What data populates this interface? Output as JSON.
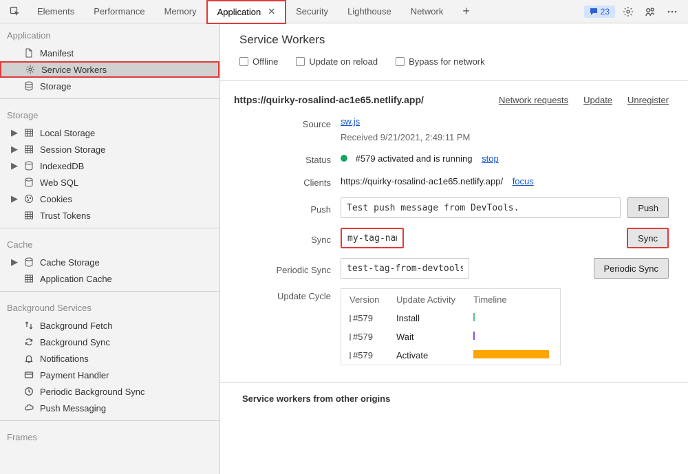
{
  "tabs": {
    "items": [
      "Elements",
      "Performance",
      "Memory",
      "Application",
      "Security",
      "Lighthouse",
      "Network"
    ],
    "active": "Application"
  },
  "issues_badge": {
    "count": "23"
  },
  "sidebar": {
    "application": {
      "title": "Application",
      "items": [
        "Manifest",
        "Service Workers",
        "Storage"
      ]
    },
    "storage": {
      "title": "Storage",
      "items": [
        "Local Storage",
        "Session Storage",
        "IndexedDB",
        "Web SQL",
        "Cookies",
        "Trust Tokens"
      ]
    },
    "cache": {
      "title": "Cache",
      "items": [
        "Cache Storage",
        "Application Cache"
      ]
    },
    "background": {
      "title": "Background Services",
      "items": [
        "Background Fetch",
        "Background Sync",
        "Notifications",
        "Payment Handler",
        "Periodic Background Sync",
        "Push Messaging"
      ]
    },
    "frames": {
      "title": "Frames"
    }
  },
  "header": {
    "title": "Service Workers",
    "checks": {
      "offline": "Offline",
      "update": "Update on reload",
      "bypass": "Bypass for network"
    }
  },
  "origin": {
    "url": "https://quirky-rosalind-ac1e65.netlify.app/",
    "actions": {
      "requests": "Network requests",
      "update": "Update",
      "unregister": "Unregister"
    }
  },
  "fields": {
    "source_lbl": "Source",
    "source_link": "sw.js",
    "received": "Received 9/21/2021, 2:49:11 PM",
    "status_lbl": "Status",
    "status_text": "#579 activated and is running",
    "status_stop": "stop",
    "clients_lbl": "Clients",
    "clients_url": "https://quirky-rosalind-ac1e65.netlify.app/",
    "clients_focus": "focus",
    "push_lbl": "Push",
    "push_val": "Test push message from DevTools.",
    "push_btn": "Push",
    "sync_lbl": "Sync",
    "sync_val": "my-tag-name",
    "sync_btn": "Sync",
    "psync_lbl": "Periodic Sync",
    "psync_val": "test-tag-from-devtools",
    "psync_btn": "Periodic Sync",
    "uc_lbl": "Update Cycle"
  },
  "update_cycle": {
    "head": {
      "c1": "Version",
      "c2": "Update Activity",
      "c3": "Timeline"
    },
    "rows": [
      {
        "version": "#579",
        "activity": "Install",
        "mark": "green"
      },
      {
        "version": "#579",
        "activity": "Wait",
        "mark": "purple"
      },
      {
        "version": "#579",
        "activity": "Activate",
        "mark": "orange"
      }
    ]
  },
  "footer": {
    "other": "Service workers from other origins"
  }
}
